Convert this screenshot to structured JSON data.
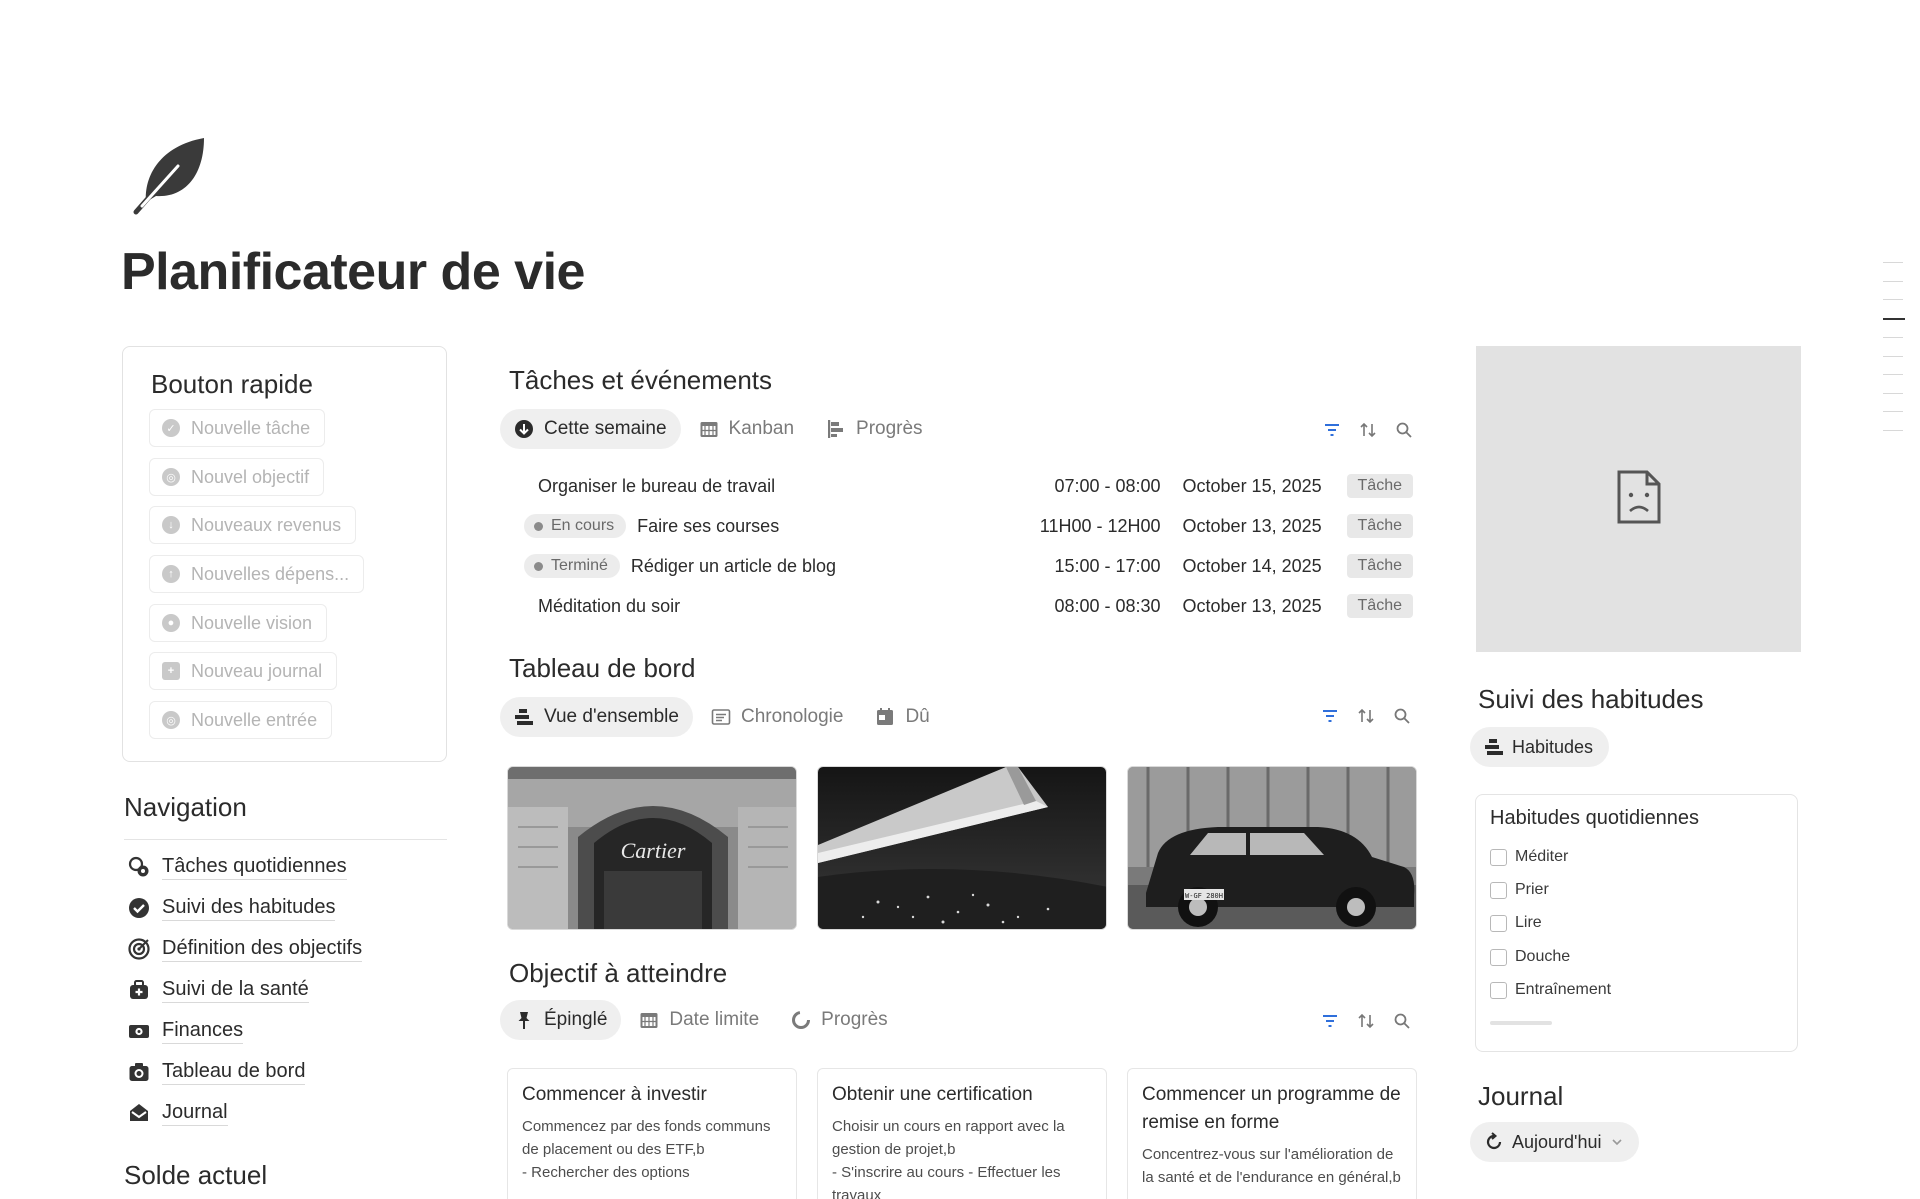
{
  "page": {
    "title": "Planificateur de vie",
    "icon": "leaf-icon"
  },
  "quick": {
    "title": "Bouton rapide",
    "buttons": [
      {
        "label": "Nouvelle tâche",
        "icon": "check-circle-icon"
      },
      {
        "label": "Nouvel objectif",
        "icon": "target-icon"
      },
      {
        "label": "Nouveaux revenus",
        "icon": "arrow-down-circle-icon"
      },
      {
        "label": "Nouvelles dépens...",
        "icon": "arrow-up-circle-icon"
      },
      {
        "label": "Nouvelle vision",
        "icon": "eye-icon"
      },
      {
        "label": "Nouveau journal",
        "icon": "medical-bag-icon"
      },
      {
        "label": "Nouvelle entrée",
        "icon": "target-icon"
      }
    ]
  },
  "navigation": {
    "title": "Navigation",
    "items": [
      {
        "label": "Tâches quotidiennes",
        "icon": "task-gear-icon"
      },
      {
        "label": "Suivi des habitudes",
        "icon": "check-circle-icon"
      },
      {
        "label": "Définition des objectifs",
        "icon": "target-icon"
      },
      {
        "label": "Suivi de la santé",
        "icon": "medical-bag-icon"
      },
      {
        "label": "Finances",
        "icon": "banknote-icon"
      },
      {
        "label": "Tableau de bord",
        "icon": "camera-icon"
      },
      {
        "label": "Journal",
        "icon": "envelope-open-icon"
      }
    ]
  },
  "solde": {
    "title": "Solde actuel"
  },
  "tasks": {
    "title": "Tâches et événements",
    "tabs": [
      {
        "label": "Cette semaine",
        "icon": "arrow-down-circle-icon",
        "active": true
      },
      {
        "label": "Kanban",
        "icon": "calendar-icon",
        "active": false
      },
      {
        "label": "Progrès",
        "icon": "timeline-icon",
        "active": false
      }
    ],
    "rows": [
      {
        "status": "",
        "name": "Organiser le bureau de travail",
        "time": "07:00 - 08:00",
        "date": "October 15, 2025",
        "tag": "Tâche"
      },
      {
        "status": "En cours",
        "name": "Faire ses courses",
        "time": "11H00 - 12H00",
        "date": "October 13, 2025",
        "tag": "Tâche"
      },
      {
        "status": "Terminé",
        "name": "Rédiger un article de blog",
        "time": "15:00 - 17:00",
        "date": "October 14, 2025",
        "tag": "Tâche"
      },
      {
        "status": "",
        "name": "Méditation du soir",
        "time": "08:00 - 08:30",
        "date": "October 13, 2025",
        "tag": "Tâche"
      }
    ]
  },
  "dashboard": {
    "title": "Tableau de bord",
    "tabs": [
      {
        "label": "Vue d'ensemble",
        "icon": "stack-icon",
        "active": true
      },
      {
        "label": "Chronologie",
        "icon": "list-box-icon",
        "active": false
      },
      {
        "label": "Dû",
        "icon": "calendar-check-icon",
        "active": false
      }
    ],
    "storefront_text": "Cartier",
    "plate_text": "W-GF 280H"
  },
  "goals": {
    "title": "Objectif à atteindre",
    "tabs": [
      {
        "label": "Épinglé",
        "icon": "pin-icon",
        "active": true
      },
      {
        "label": "Date limite",
        "icon": "calendar-icon",
        "active": false
      },
      {
        "label": "Progrès",
        "icon": "progress-icon",
        "active": false
      }
    ],
    "cards": [
      {
        "title": "Commencer à investir",
        "desc": "Commencez par des fonds communs de placement ou des ETF,b",
        "desc2": "- Rechercher des options"
      },
      {
        "title": "Obtenir une certification",
        "desc": "Choisir un cours en rapport avec la gestion de projet,b",
        "desc2": "- S'inscrire au cours - Effectuer les travaux"
      },
      {
        "title": "Commencer un programme de remise en forme",
        "desc": "Concentrez-vous sur l'amélioration de la santé et de l'endurance en général,b",
        "desc2": ""
      }
    ]
  },
  "habits": {
    "title": "Suivi des habitudes",
    "pill": "Habitudes",
    "card_title": "Habitudes quotidiennes",
    "items": [
      "Méditer",
      "Prier",
      "Lire",
      "Douche",
      "Entraînement"
    ]
  },
  "journal": {
    "title": "Journal",
    "pill": "Aujourd'hui"
  },
  "colors": {
    "text": "#2b2b2b",
    "muted": "#7a7a7a",
    "accent": "#2f6fdb",
    "pill_bg": "#efefef"
  }
}
